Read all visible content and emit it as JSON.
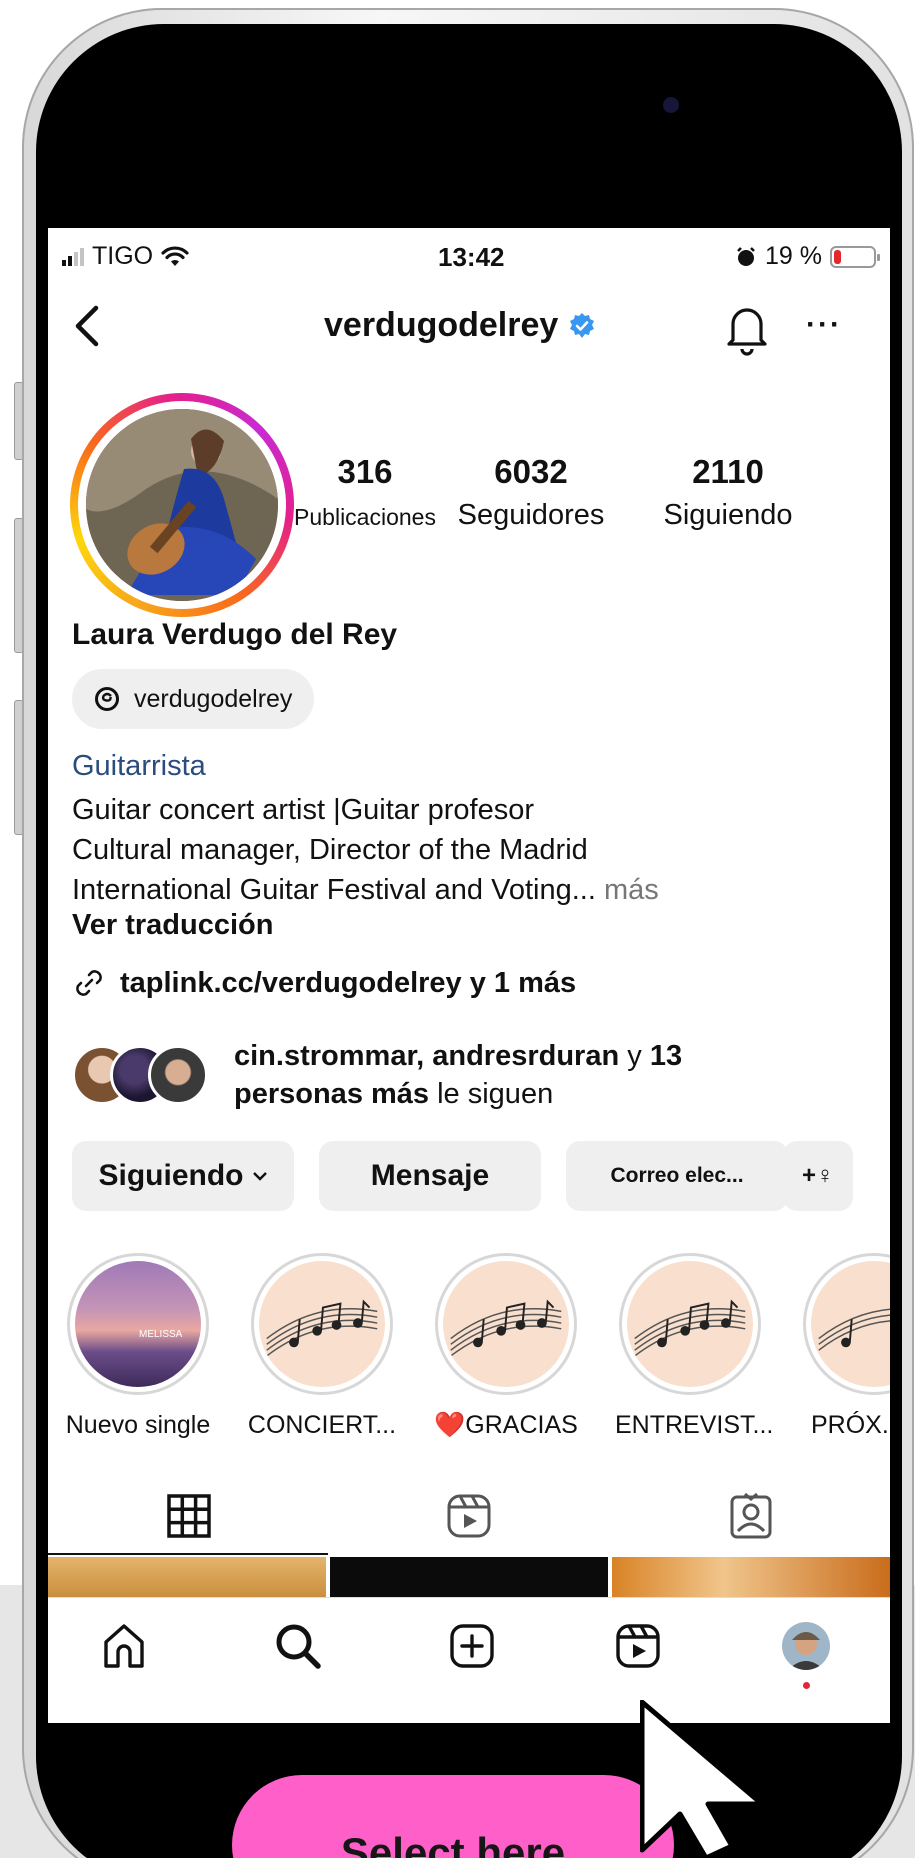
{
  "status_bar": {
    "carrier": "TIGO",
    "time": "13:42",
    "battery": "19 %",
    "battery_level": 0.19
  },
  "header": {
    "username": "verdugodelrey",
    "more": "···"
  },
  "profile": {
    "stats": [
      {
        "value": "316",
        "label": "Publicaciones"
      },
      {
        "value": "6032",
        "label": "Seguidores"
      },
      {
        "value": "2110",
        "label": "Siguiendo"
      }
    ],
    "full_name": "Laura Verdugo del Rey",
    "threads_handle": "verdugodelrey",
    "category": "Guitarrista",
    "bio_lines": [
      "Guitar concert artist |Guitar profesor",
      "Cultural manager, Director of the Madrid",
      "International Guitar Festival and Voting..."
    ],
    "bio_more": "más",
    "translate": "Ver traducción",
    "link": "taplink.cc/verdugodelrey y 1 más",
    "followed_by": {
      "names": "cin.strommar, andresrduran",
      "y": "y",
      "count": "13",
      "personas": "personas más",
      "suffix": "le siguen"
    }
  },
  "actions": {
    "following": "Siguiendo",
    "message": "Mensaje",
    "email": "Correo elec...",
    "add_person": "+♀"
  },
  "highlights": [
    {
      "label": "Nuevo single",
      "inner_text": "MELISSA"
    },
    {
      "label": "CONCIERT..."
    },
    {
      "label": "GRACIAS",
      "emoji": "❤️"
    },
    {
      "label": "ENTREVIST..."
    },
    {
      "label": "PRÓX.E"
    }
  ],
  "callout": {
    "label": "Select here"
  },
  "colors": {
    "callout": "#ff5fc8",
    "verified": "#3897f0",
    "category": "#2a4d7d",
    "notification_dot": "#e0263b"
  }
}
